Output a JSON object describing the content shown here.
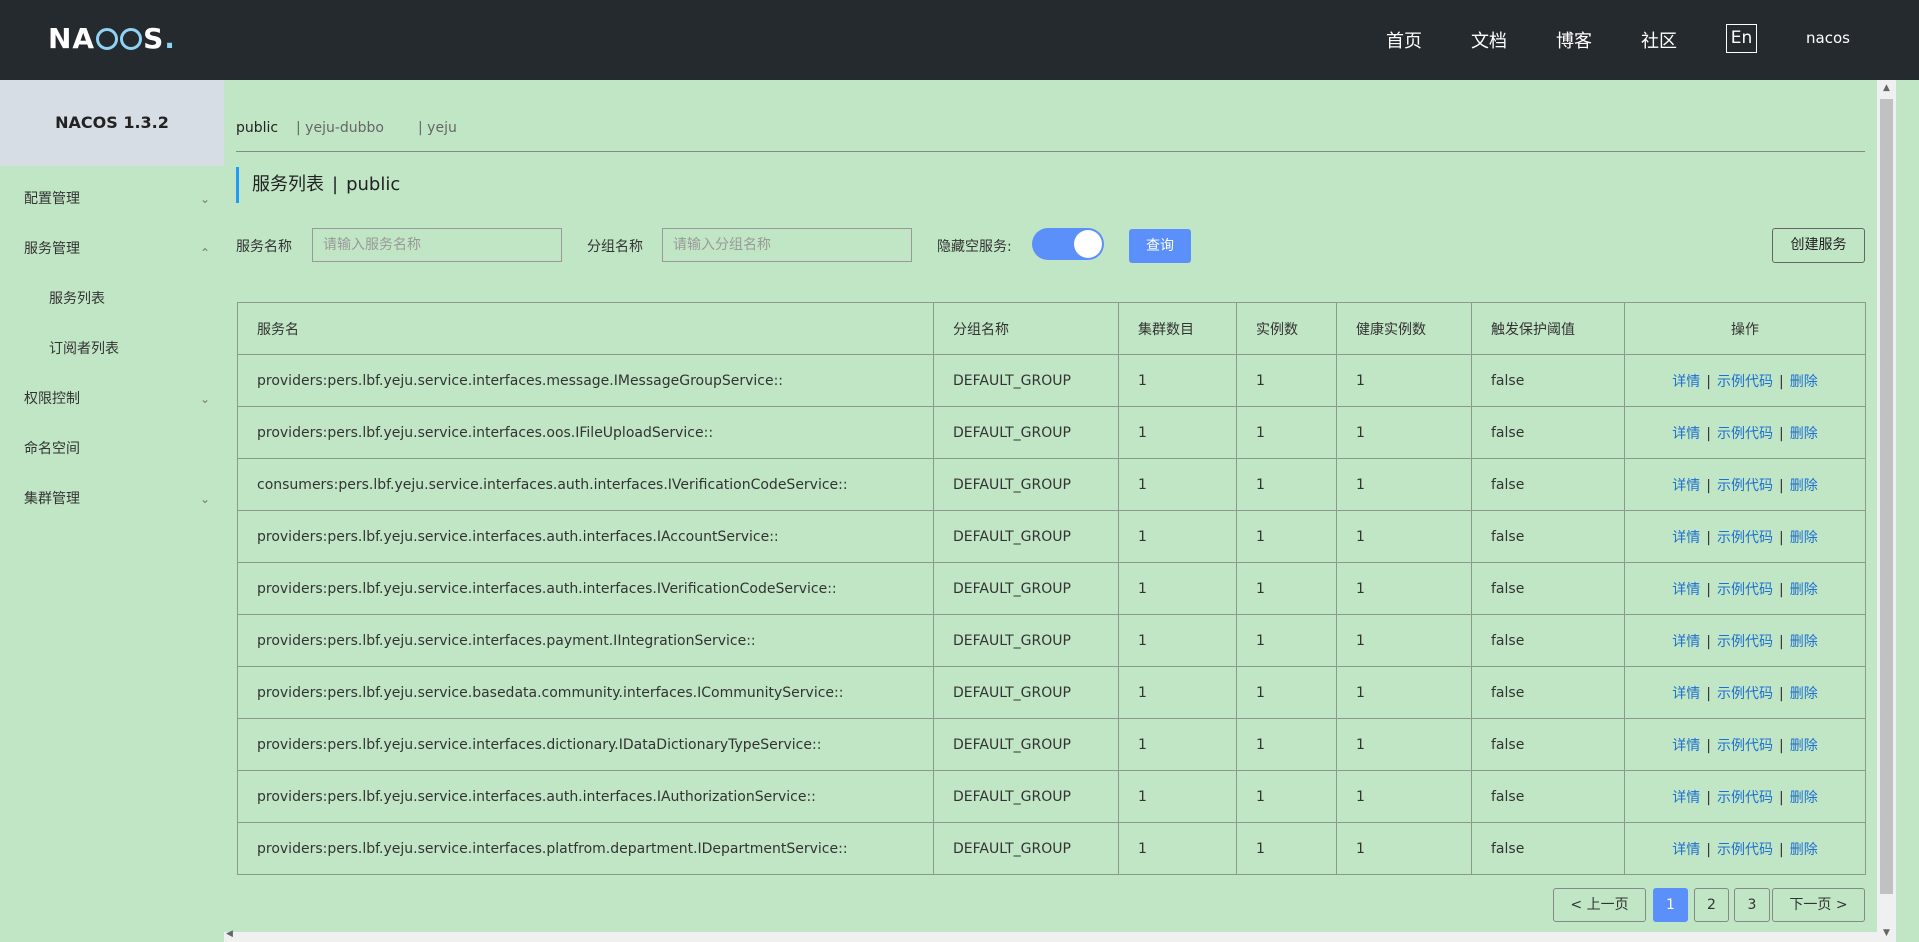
{
  "header": {
    "logo": "NACOS.",
    "nav": [
      "首页",
      "文档",
      "博客",
      "社区"
    ],
    "lang_button": "En",
    "user": "nacos"
  },
  "sidebar": {
    "title": "NACOS 1.3.2",
    "items": [
      {
        "label": "配置管理",
        "expanded": false,
        "has_children": true
      },
      {
        "label": "服务管理",
        "expanded": true,
        "has_children": true
      },
      {
        "label": "服务列表",
        "sub": true
      },
      {
        "label": "订阅者列表",
        "sub": true
      },
      {
        "label": "权限控制",
        "expanded": false,
        "has_children": true
      },
      {
        "label": "命名空间",
        "has_children": false
      },
      {
        "label": "集群管理",
        "expanded": false,
        "has_children": true
      }
    ]
  },
  "namespaces": [
    {
      "label": "public",
      "active": true
    },
    {
      "label": "| yeju-dubbo",
      "active": false
    },
    {
      "label": "| yeju",
      "active": false
    }
  ],
  "page": {
    "title": "服务列表",
    "separator": "|",
    "namespace": "public"
  },
  "filters": {
    "service_name_label": "服务名称",
    "service_name_placeholder": "请输入服务名称",
    "group_name_label": "分组名称",
    "group_name_placeholder": "请输入分组名称",
    "hide_empty_label": "隐藏空服务:",
    "hide_empty_on": true,
    "query_button": "查询",
    "create_button": "创建服务"
  },
  "table": {
    "columns": [
      "服务名",
      "分组名称",
      "集群数目",
      "实例数",
      "健康实例数",
      "触发保护阈值",
      "操作"
    ],
    "actions": [
      "详情",
      "示例代码",
      "删除"
    ],
    "rows": [
      {
        "name": "providers:pers.lbf.yeju.service.interfaces.message.IMessageGroupService::",
        "group": "DEFAULT_GROUP",
        "clusters": "1",
        "instances": "1",
        "healthy": "1",
        "threshold": "false"
      },
      {
        "name": "providers:pers.lbf.yeju.service.interfaces.oos.IFileUploadService::",
        "group": "DEFAULT_GROUP",
        "clusters": "1",
        "instances": "1",
        "healthy": "1",
        "threshold": "false"
      },
      {
        "name": "consumers:pers.lbf.yeju.service.interfaces.auth.interfaces.IVerificationCodeService::",
        "group": "DEFAULT_GROUP",
        "clusters": "1",
        "instances": "1",
        "healthy": "1",
        "threshold": "false"
      },
      {
        "name": "providers:pers.lbf.yeju.service.interfaces.auth.interfaces.IAccountService::",
        "group": "DEFAULT_GROUP",
        "clusters": "1",
        "instances": "1",
        "healthy": "1",
        "threshold": "false"
      },
      {
        "name": "providers:pers.lbf.yeju.service.interfaces.auth.interfaces.IVerificationCodeService::",
        "group": "DEFAULT_GROUP",
        "clusters": "1",
        "instances": "1",
        "healthy": "1",
        "threshold": "false"
      },
      {
        "name": "providers:pers.lbf.yeju.service.interfaces.payment.IIntegrationService::",
        "group": "DEFAULT_GROUP",
        "clusters": "1",
        "instances": "1",
        "healthy": "1",
        "threshold": "false"
      },
      {
        "name": "providers:pers.lbf.yeju.service.basedata.community.interfaces.ICommunityService::",
        "group": "DEFAULT_GROUP",
        "clusters": "1",
        "instances": "1",
        "healthy": "1",
        "threshold": "false"
      },
      {
        "name": "providers:pers.lbf.yeju.service.interfaces.dictionary.IDataDictionaryTypeService::",
        "group": "DEFAULT_GROUP",
        "clusters": "1",
        "instances": "1",
        "healthy": "1",
        "threshold": "false"
      },
      {
        "name": "providers:pers.lbf.yeju.service.interfaces.auth.interfaces.IAuthorizationService::",
        "group": "DEFAULT_GROUP",
        "clusters": "1",
        "instances": "1",
        "healthy": "1",
        "threshold": "false"
      },
      {
        "name": "providers:pers.lbf.yeju.service.interfaces.platfrom.department.IDepartmentService::",
        "group": "DEFAULT_GROUP",
        "clusters": "1",
        "instances": "1",
        "healthy": "1",
        "threshold": "false"
      }
    ]
  },
  "pagination": {
    "prev": "上一页",
    "next": "下一页",
    "pages": [
      "1",
      "2",
      "3"
    ],
    "current": "1"
  },
  "colors": {
    "header_bg": "#252a2f",
    "page_bg": "#c1e6c6",
    "accent": "#5b8ff9",
    "link": "#1f6fd1"
  }
}
